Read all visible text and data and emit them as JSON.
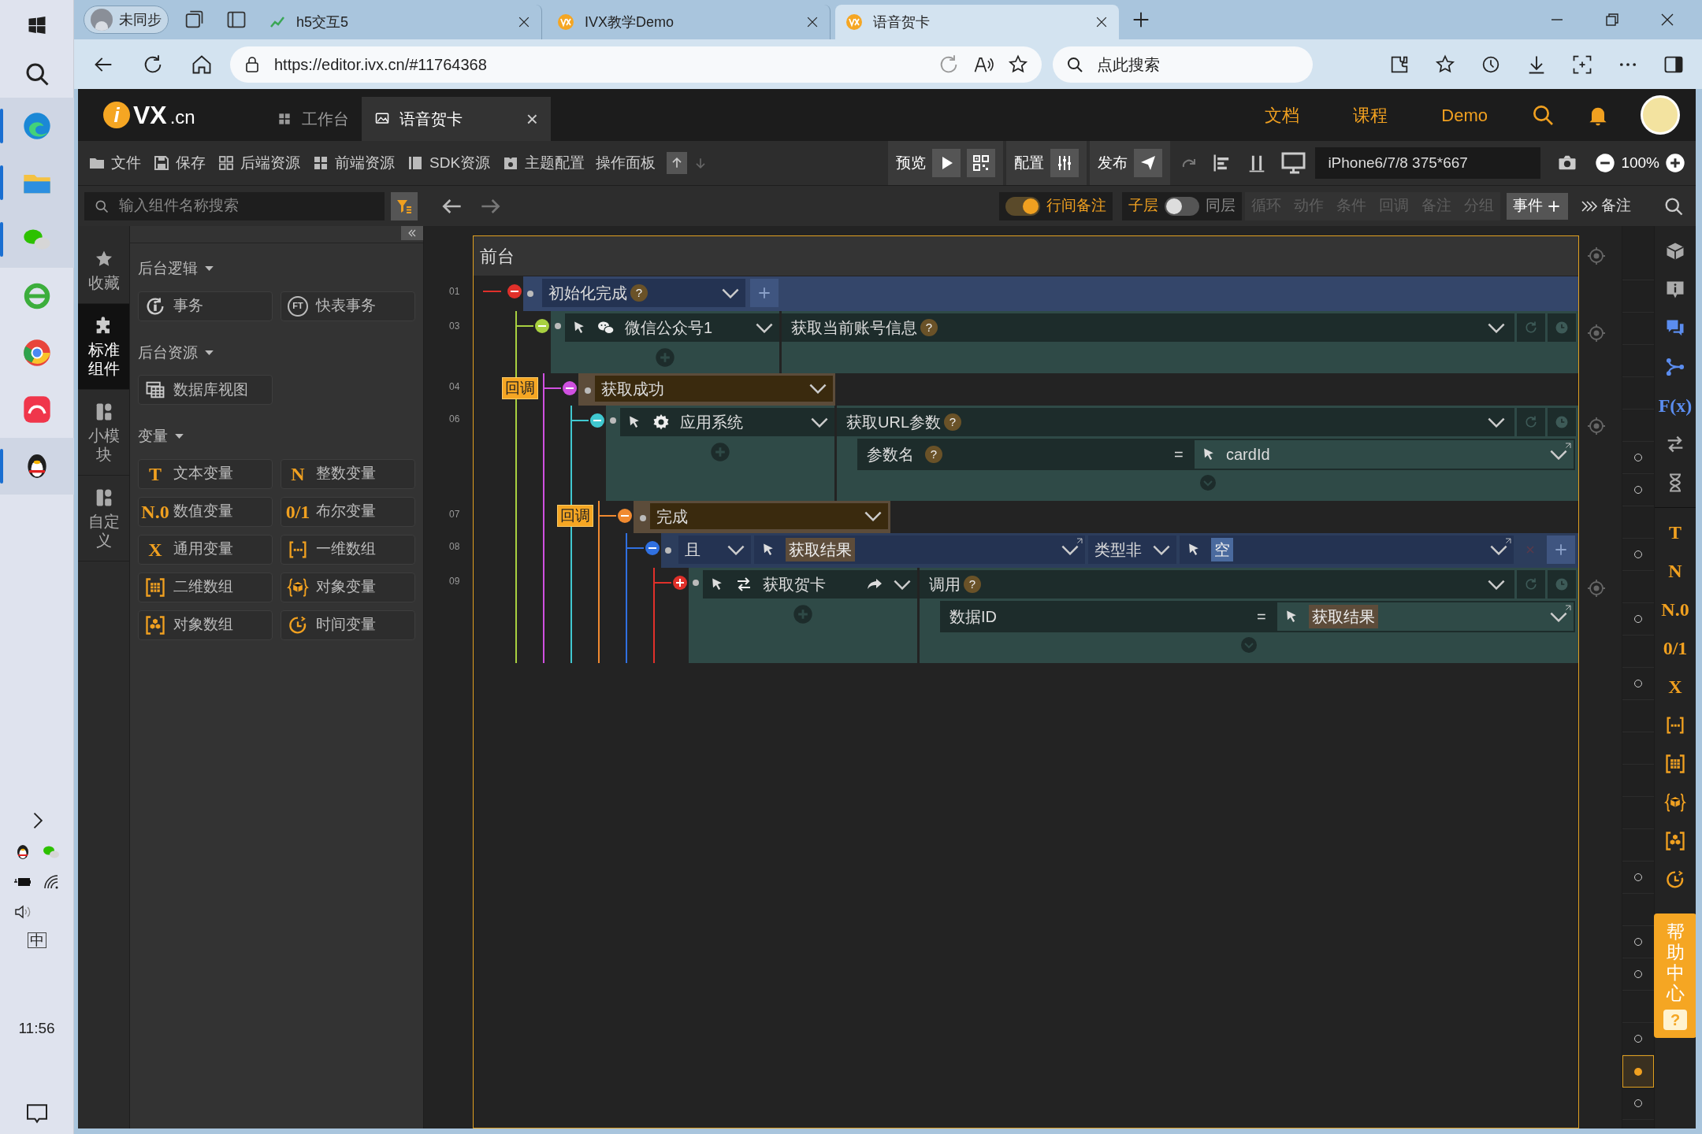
{
  "taskbar": {
    "apps": [
      {
        "kind": "edge",
        "active": true
      },
      {
        "kind": "folder",
        "active": true
      },
      {
        "kind": "wechat",
        "active": true
      },
      {
        "kind": "ie",
        "active": false
      },
      {
        "kind": "chrome",
        "active": false
      },
      {
        "kind": "red-app",
        "active": false
      },
      {
        "kind": "penguin",
        "active": true
      }
    ],
    "ime": "中",
    "clock": "11:56"
  },
  "browser": {
    "profile": "未同步",
    "tabs": [
      {
        "title": "h5交互5",
        "selected": false
      },
      {
        "title": "IVX教学Demo",
        "selected": false
      },
      {
        "title": "语音贺卡",
        "selected": true
      }
    ],
    "url": "https://editor.ivx.cn/#11764368",
    "search_placeholder": "点此搜索"
  },
  "app": {
    "logo_mark": "i",
    "logo": "VX",
    "logo_suffix": ".cn",
    "tabs": [
      {
        "label": "工作台",
        "selected": false
      },
      {
        "label": "语音贺卡",
        "selected": true
      }
    ],
    "tab_close": "×",
    "nav": [
      "文档",
      "课程",
      "Demo"
    ]
  },
  "toolbar": {
    "items": [
      {
        "label": "文件",
        "kind": "folder"
      },
      {
        "label": "保存",
        "kind": "save"
      },
      {
        "label": "后端资源",
        "kind": "grid4"
      },
      {
        "label": "前端资源",
        "kind": "grid4b"
      },
      {
        "label": "SDK资源",
        "kind": "sdk"
      },
      {
        "label": "主题配置",
        "kind": "theme"
      },
      {
        "label": "操作面板",
        "kind": "none"
      }
    ],
    "groups": [
      {
        "label": "预览"
      },
      {
        "label": "配置"
      },
      {
        "label": "发布"
      }
    ],
    "device": "iPhone6/7/8 375*667",
    "zoom": "100%"
  },
  "filterbar": {
    "search_placeholder": "输入组件名称搜索",
    "inline_notes": {
      "label": "行间备注",
      "on": true
    },
    "layer": {
      "label": "子层",
      "on": false
    },
    "same_layer": "同层",
    "filters": [
      "循环",
      "动作",
      "条件",
      "回调",
      "备注",
      "分组"
    ],
    "event_button": "事件",
    "notes_button": "备注"
  },
  "sidebar": {
    "tabs": [
      {
        "label": "收藏",
        "kind": "star",
        "selected": false
      },
      {
        "label": "标准组件",
        "kind": "puzzle",
        "selected": true
      },
      {
        "label": "小模块",
        "kind": "blocks",
        "selected": false
      },
      {
        "label": "自定义",
        "kind": "blocks",
        "selected": false
      }
    ],
    "sections": [
      {
        "title": "后台逻辑",
        "items": [
          {
            "label": "事务",
            "kind": "txn"
          },
          {
            "label": "快表事务",
            "kind": "glyph",
            "glyph": "FT"
          }
        ]
      },
      {
        "title": "后台资源",
        "items": [
          {
            "label": "数据库视图",
            "kind": "database"
          }
        ]
      },
      {
        "title": "变量",
        "items": [
          {
            "label": "文本变量",
            "kind": "glyph",
            "glyph": "T"
          },
          {
            "label": "整数变量",
            "kind": "glyph",
            "glyph": "N"
          },
          {
            "label": "数值变量",
            "kind": "glyph",
            "glyph": "N.0"
          },
          {
            "label": "布尔变量",
            "kind": "glyph",
            "glyph": "0/1"
          },
          {
            "label": "通用变量",
            "kind": "glyph",
            "glyph": "X"
          },
          {
            "label": "一维数组",
            "kind": "array"
          },
          {
            "label": "二维数组",
            "kind": "grid2d"
          },
          {
            "label": "对象变量",
            "kind": "cube"
          },
          {
            "label": "对象数组",
            "kind": "cubes"
          },
          {
            "label": "时间变量",
            "kind": "clock"
          }
        ]
      }
    ]
  },
  "canvas": {
    "scope_title": "前台",
    "rows": [
      {
        "line": "01",
        "kind": "event",
        "color": "#e0302a",
        "expanded": true,
        "name": "初始化完成",
        "help": "?",
        "children": [
          {
            "line": "03",
            "kind": "action",
            "color": "#a8d040",
            "expanded": true,
            "target": {
              "name": "微信公众号1",
              "kind": "wechat"
            },
            "action": "获取当前账号信息",
            "help": "?",
            "children": [
              {
                "line": "04",
                "kind": "callback",
                "tag": "回调",
                "color": "#d050e0",
                "expanded": true,
                "name": "获取成功",
                "children": [
                  {
                    "line": "06",
                    "kind": "action",
                    "color": "#40c8d0",
                    "expanded": true,
                    "target": {
                      "name": "应用系统",
                      "kind": "gear"
                    },
                    "action": "获取URL参数",
                    "help": "?",
                    "params": [
                      {
                        "label": "参数名",
                        "help": "?",
                        "op": "=",
                        "value": {
                          "text": "cardId",
                          "kind": "text"
                        }
                      }
                    ],
                    "children": [
                      {
                        "line": "07",
                        "kind": "callback",
                        "tag": "回调",
                        "color": "#f08a30",
                        "expanded": true,
                        "name": "完成",
                        "children": [
                          {
                            "line": "08",
                            "kind": "condition",
                            "color": "#3070e0",
                            "expanded": true,
                            "logic": "且",
                            "left": "获取结果",
                            "operator": "类型非",
                            "right": "空",
                            "children": [
                              {
                                "line": "09",
                                "kind": "action",
                                "color": "#e0302a",
                                "expanded": false,
                                "target": {
                                  "name": "获取贺卡",
                                  "kind": "swap"
                                },
                                "action": "调用",
                                "help": "?",
                                "params": [
                                  {
                                    "label": "数据ID",
                                    "op": "=",
                                    "value": {
                                      "text": "获取结果",
                                      "kind": "chip"
                                    }
                                  }
                                ]
                              }
                            ]
                          }
                        ]
                      }
                    ]
                  }
                ]
              }
            ]
          }
        ]
      }
    ]
  },
  "right_tools": [
    {
      "kind": "box"
    },
    {
      "kind": "info"
    },
    {
      "kind": "chat"
    },
    {
      "kind": "branch"
    },
    {
      "kind": "glyph",
      "glyph": "F(x)",
      "color": "#5b8def"
    },
    {
      "kind": "swap"
    },
    {
      "kind": "hourglass"
    },
    {
      "kind": "glyph",
      "glyph": "T",
      "color": "#f0a020"
    },
    {
      "kind": "glyph",
      "glyph": "N",
      "color": "#f0a020"
    },
    {
      "kind": "glyph",
      "glyph": "N.0",
      "color": "#f0a020"
    },
    {
      "kind": "glyph",
      "glyph": "0/1",
      "color": "#f0a020"
    },
    {
      "kind": "glyph",
      "glyph": "X",
      "color": "#f0a020"
    },
    {
      "kind": "array"
    },
    {
      "kind": "grid2d"
    },
    {
      "kind": "cube"
    },
    {
      "kind": "cubes"
    },
    {
      "kind": "clock"
    }
  ],
  "help_center": {
    "label": "帮助中心",
    "mark": "?"
  },
  "ruler": [
    {
      "kind": "empty"
    },
    {
      "kind": "empty"
    },
    {
      "kind": "empty"
    },
    {
      "kind": "empty"
    },
    {
      "kind": "empty"
    },
    {
      "kind": "empty"
    },
    {
      "kind": "circle"
    },
    {
      "kind": "circle"
    },
    {
      "kind": "empty"
    },
    {
      "kind": "circle"
    },
    {
      "kind": "empty"
    },
    {
      "kind": "circle"
    },
    {
      "kind": "empty"
    },
    {
      "kind": "circle"
    },
    {
      "kind": "empty"
    },
    {
      "kind": "empty"
    },
    {
      "kind": "empty"
    },
    {
      "kind": "empty"
    },
    {
      "kind": "empty"
    },
    {
      "kind": "circle"
    },
    {
      "kind": "empty"
    },
    {
      "kind": "circle"
    },
    {
      "kind": "circle"
    },
    {
      "kind": "empty"
    },
    {
      "kind": "circle"
    },
    {
      "kind": "selected"
    },
    {
      "kind": "circle"
    }
  ]
}
